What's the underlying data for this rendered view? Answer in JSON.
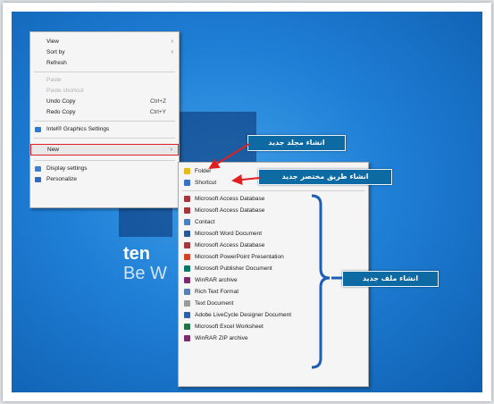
{
  "context_menu": {
    "items": [
      {
        "label": "View",
        "arrow": "›"
      },
      {
        "label": "Sort by",
        "arrow": "›"
      },
      {
        "label": "Refresh"
      },
      {
        "label": "Paste",
        "disabled": true
      },
      {
        "label": "Paste shortcut",
        "disabled": true
      },
      {
        "label": "Undo Copy",
        "shortcut": "Ctrl+Z"
      },
      {
        "label": "Redo Copy",
        "shortcut": "Ctrl+Y"
      },
      {
        "label": "Intel® Graphics Settings"
      },
      {
        "label": "New",
        "arrow": "›"
      },
      {
        "label": "Display settings"
      },
      {
        "label": "Personalize"
      }
    ]
  },
  "new_submenu": {
    "items": [
      {
        "label": "Folder",
        "icon": "folder-icon",
        "color": "#e8b923"
      },
      {
        "label": "Shortcut",
        "icon": "shortcut-icon",
        "color": "#3a6fc4"
      },
      {
        "label": "Microsoft Access Database",
        "icon": "access-icon",
        "color": "#a4373a"
      },
      {
        "label": "Microsoft Access Database",
        "icon": "access-icon",
        "color": "#a4373a"
      },
      {
        "label": "Contact",
        "icon": "contact-icon",
        "color": "#4a7fc1"
      },
      {
        "label": "Microsoft Word Document",
        "icon": "word-icon",
        "color": "#2b579a"
      },
      {
        "label": "Microsoft Access Database",
        "icon": "access-icon",
        "color": "#a4373a"
      },
      {
        "label": "Microsoft PowerPoint Presentation",
        "icon": "powerpoint-icon",
        "color": "#d04423"
      },
      {
        "label": "Microsoft Publisher Document",
        "icon": "publisher-icon",
        "color": "#077568"
      },
      {
        "label": "WinRAR archive",
        "icon": "winrar-icon",
        "color": "#7a2a6e"
      },
      {
        "label": "Rich Text Format",
        "icon": "rtf-icon",
        "color": "#5b7fb5"
      },
      {
        "label": "Text Document",
        "icon": "text-icon",
        "color": "#9a9a9a"
      },
      {
        "label": "Adobe LiveCycle Designer Document",
        "icon": "adobe-icon",
        "color": "#2f5fa6"
      },
      {
        "label": "Microsoft Excel Worksheet",
        "icon": "excel-icon",
        "color": "#217346"
      },
      {
        "label": "WinRAR ZIP archive",
        "icon": "winrar-zip-icon",
        "color": "#7a2a6e"
      }
    ]
  },
  "desktop": {
    "line1": "ten",
    "line2": "Be W"
  },
  "callouts": {
    "folder": "انشاء مجلد جديد",
    "shortcut": "انشاء طريق مختصر جديد",
    "file": "انشاء ملف جديد"
  },
  "colors": {
    "callout_bg": "#0e6aa3",
    "highlight_border": "#e02020",
    "desktop_bg": "#1f7fd6"
  }
}
